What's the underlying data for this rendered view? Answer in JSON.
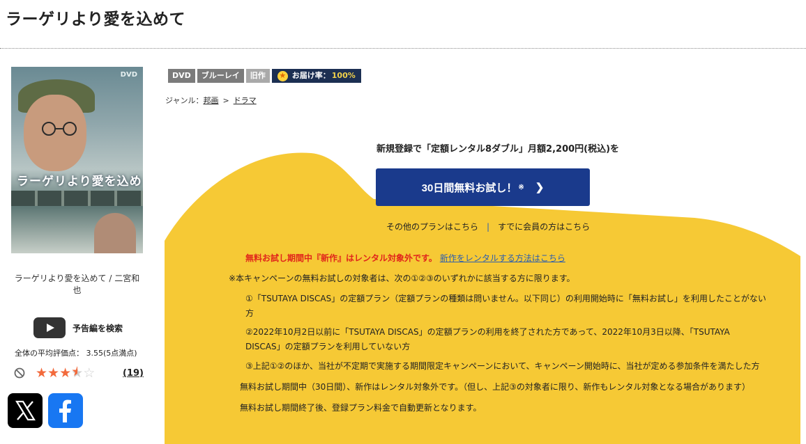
{
  "page": {
    "title": "ラーゲリより愛を込めて"
  },
  "poster": {
    "dvd_mark": "DVD",
    "caption": "ラーゲリより愛を込めて"
  },
  "product": {
    "caption": "ラーゲリより愛を込めて / 二宮和也"
  },
  "trailer": {
    "label": "予告編を検索"
  },
  "rating": {
    "average_text": "全体の平均評価点：  3.55(5点満点)",
    "average": 3.55,
    "max": 5,
    "review_count": "(19)",
    "star_color": "#f26a3c"
  },
  "social": {
    "x": "x-logo-icon",
    "facebook": "facebook-logo-icon"
  },
  "tags": {
    "dvd": "DVD",
    "bluray": "ブルーレイ",
    "old": "旧作",
    "delivery_label": "お届け率：",
    "delivery_value": "100%"
  },
  "genre": {
    "label": "ジャンル：",
    "items": [
      "邦画",
      "ドラマ"
    ],
    "separator": ">"
  },
  "campaign": {
    "headline": "新規登録で「定額レンタル8ダブル」月額2,200円(税込)を",
    "cta_label": "30日間無料お試し！",
    "cta_mark": "※",
    "other_plans": "その他のプランはこちら",
    "separator": "|",
    "members": "すでに会員の方はこちら",
    "accent": "#f6c935",
    "button_color": "#1a3a8c"
  },
  "notice": {
    "warning": "無料お試し期間中『新作』はレンタル対象外です。",
    "link": "新作をレンタルする方法はこちら"
  },
  "conditions": {
    "intro": "※本キャンペーンの無料お試しの対象者は、次の①②③のいずれかに該当する方に限ります。",
    "c1_line1": "①「TSUTAYA DISCAS」の定額プラン（定額プランの種類は問いません。以下同じ）の利用開始時に「無料お試し」を利用したことがない",
    "c1_line2": "方",
    "c2_line1": "②2022年10月2日以前に「TSUTAYA DISCAS」の定額プランの利用を終了された方であって、2022年10月3日以降、「TSUTAYA",
    "c2_line2": "DISCAS」の定額プランを利用していない方",
    "c3": "③上記①②のほか、当社が不定期で実施する期間限定キャンペーンにおいて、キャンペーン開始時に、当社が定める参加条件を満たした方",
    "note1": "無料お試し期間中（30日間）、新作はレンタル対象外です。（但し、上記③の対象者に限り、新作もレンタル対象となる場合があります）",
    "note2": "無料お試し期間終了後、登録プラン料金で自動更新となります。"
  }
}
